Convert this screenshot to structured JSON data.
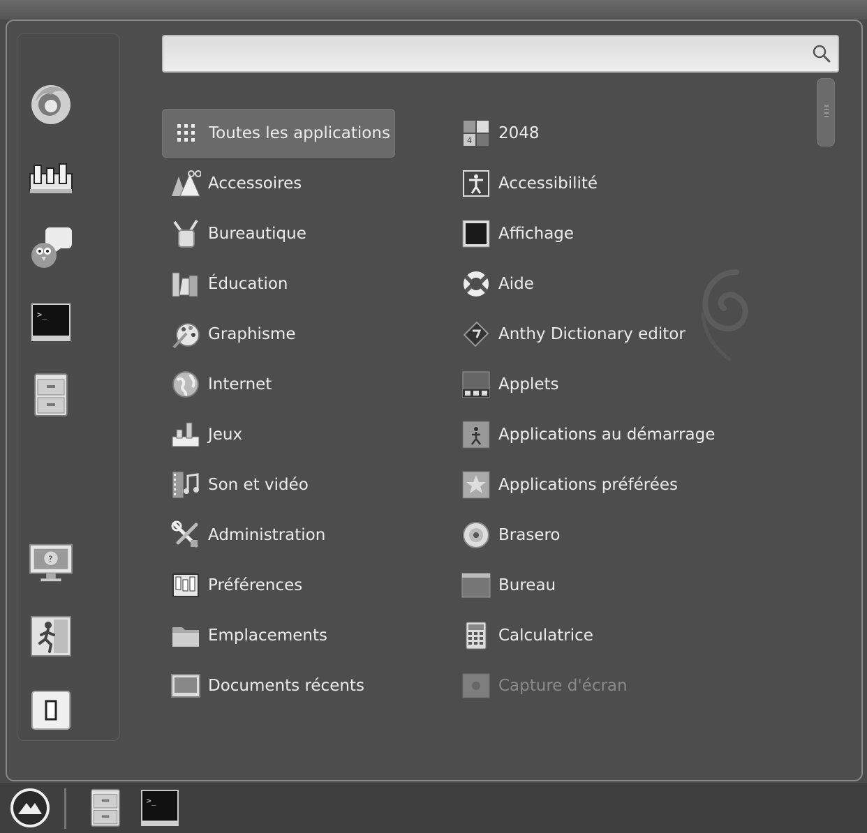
{
  "search": {
    "value": "",
    "placeholder": ""
  },
  "favorites": [
    {
      "name": "firefox-icon"
    },
    {
      "name": "settings-icon"
    },
    {
      "name": "pidgin-icon"
    },
    {
      "name": "terminal-icon"
    },
    {
      "name": "file-cabinet-icon"
    },
    {
      "name": "lock-screen-icon"
    },
    {
      "name": "logout-icon"
    },
    {
      "name": "shutdown-icon"
    }
  ],
  "categories": [
    {
      "label": "Toutes les applications",
      "icon": "grid-icon",
      "active": true
    },
    {
      "label": "Accessoires",
      "icon": "accessories-icon"
    },
    {
      "label": "Bureautique",
      "icon": "office-icon"
    },
    {
      "label": "Éducation",
      "icon": "education-icon"
    },
    {
      "label": "Graphisme",
      "icon": "graphics-icon"
    },
    {
      "label": "Internet",
      "icon": "internet-icon"
    },
    {
      "label": "Jeux",
      "icon": "games-icon"
    },
    {
      "label": "Son et vidéo",
      "icon": "multimedia-icon"
    },
    {
      "label": "Administration",
      "icon": "administration-icon"
    },
    {
      "label": "Préférences",
      "icon": "preferences-icon"
    },
    {
      "label": "Emplacements",
      "icon": "folder-icon"
    },
    {
      "label": "Documents récents",
      "icon": "recent-documents-icon"
    }
  ],
  "apps": [
    {
      "label": "2048",
      "icon": "game-2048-icon"
    },
    {
      "label": "Accessibilité",
      "icon": "accessibility-icon"
    },
    {
      "label": "Affichage",
      "icon": "display-icon"
    },
    {
      "label": "Aide",
      "icon": "help-lifebuoy-icon"
    },
    {
      "label": "Anthy Dictionary editor",
      "icon": "dictionary-icon"
    },
    {
      "label": "Applets",
      "icon": "applets-icon"
    },
    {
      "label": "Applications au démarrage",
      "icon": "startup-apps-icon"
    },
    {
      "label": "Applications préférées",
      "icon": "preferred-apps-icon"
    },
    {
      "label": "Brasero",
      "icon": "disc-icon"
    },
    {
      "label": "Bureau",
      "icon": "desktop-icon"
    },
    {
      "label": "Calculatrice",
      "icon": "calculator-icon"
    },
    {
      "label": "Capture d'écran",
      "icon": "screenshot-icon",
      "dim": true
    }
  ],
  "panel": {
    "menu_icon": "menu-logo-icon",
    "launchers": [
      "file-cabinet-icon",
      "terminal-icon"
    ]
  }
}
